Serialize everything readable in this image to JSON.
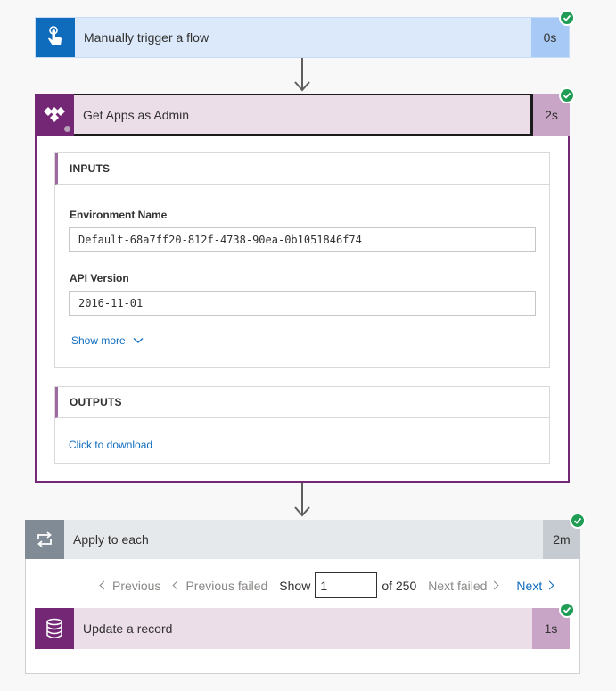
{
  "trigger": {
    "title": "Manually trigger a flow",
    "duration": "0s"
  },
  "get_apps": {
    "title": "Get Apps as Admin",
    "duration": "2s",
    "inputs_header": "INPUTS",
    "fields": [
      {
        "label": "Environment Name",
        "value": "Default-68a7ff20-812f-4738-90ea-0b1051846f74"
      },
      {
        "label": "API Version",
        "value": "2016-11-01"
      }
    ],
    "show_more": "Show more",
    "outputs_header": "OUTPUTS",
    "download_link": "Click to download"
  },
  "apply_each": {
    "title": "Apply to each",
    "duration": "2m",
    "pager": {
      "previous": "Previous",
      "previous_failed": "Previous failed",
      "show_label": "Show",
      "current": "1",
      "of_total": "of 250",
      "next_failed": "Next failed",
      "next": "Next"
    }
  },
  "update_record": {
    "title": "Update a record",
    "duration": "1s"
  },
  "colors": {
    "trigger_accent": "#0f6cbd",
    "trigger_bg": "#dbe9fa",
    "trigger_dur_bg": "#a7c9f5",
    "admin_accent": "#742774",
    "admin_bg": "#ebdee9",
    "admin_dur_bg": "#c8a5c6",
    "loop_accent": "#808b95",
    "loop_bg": "#e6e9ec",
    "loop_dur_bg": "#c5cbd0",
    "success": "#1f9d55",
    "link": "#0f6cbd"
  }
}
